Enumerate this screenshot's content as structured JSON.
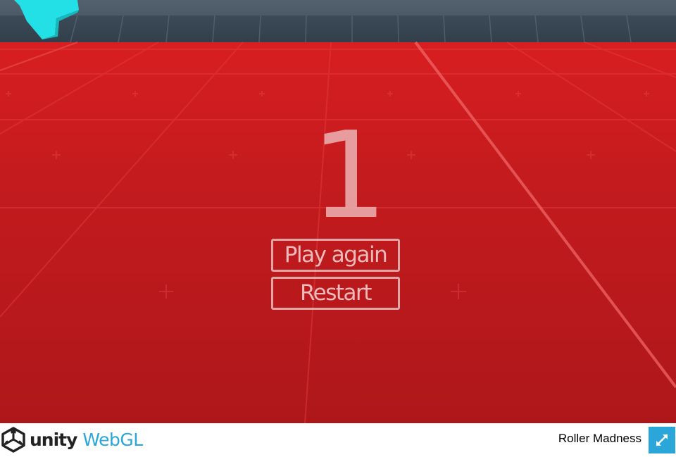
{
  "game": {
    "score": "1",
    "buttons": {
      "play_again": "Play again",
      "restart": "Restart"
    }
  },
  "footer": {
    "logo_unity": "unity",
    "logo_webgl": "WebGL",
    "title": "Roller Madness",
    "fullscreen_icon": "fullscreen-icon"
  },
  "colors": {
    "floor": "#b3191b",
    "wall": "#3b4a57",
    "cyan_block": "#22e0e6",
    "webgl_accent": "#2aa6d8"
  }
}
